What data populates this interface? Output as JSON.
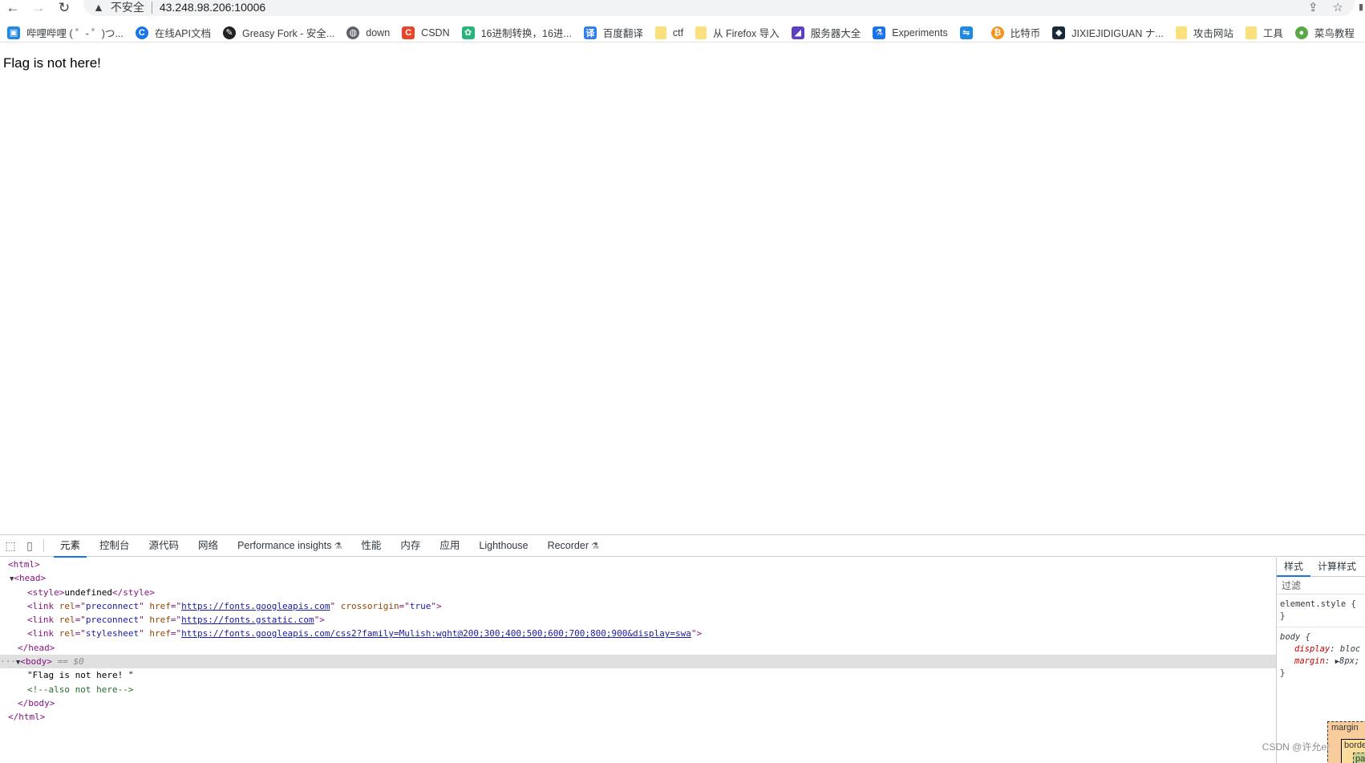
{
  "browser": {
    "security_label": "不安全",
    "url": "43.248.98.206:10006"
  },
  "bookmarks": [
    {
      "label": "哔哩哔哩 ( ゜- ゜)つ...",
      "icon": "bilibili-icon",
      "color": "#1e88e5"
    },
    {
      "label": "在线API文档",
      "icon": "c-logo-icon",
      "color": "#1a73e8"
    },
    {
      "label": "Greasy Fork - 安全...",
      "icon": "greasyfork-icon",
      "color": "#222222"
    },
    {
      "label": "down",
      "icon": "globe-icon",
      "color": "#5f6368"
    },
    {
      "label": "CSDN",
      "icon": "csdn-icon",
      "color": "#e8452a"
    },
    {
      "label": "16进制转换，16进...",
      "icon": "gear-icon",
      "color": "#28b47d"
    },
    {
      "label": "百度翻译",
      "icon": "translate-icon",
      "color": "#2f7ff0"
    },
    {
      "label": "ctf",
      "icon": "folder-icon",
      "color": "#fbe07b"
    },
    {
      "label": "从 Firefox 导入",
      "icon": "folder-icon",
      "color": "#fbe07b"
    },
    {
      "label": "服务器大全",
      "icon": "server-icon",
      "color": "#5b3fc4"
    },
    {
      "label": "Experiments",
      "icon": "flask-icon",
      "color": "#1a73e8"
    },
    {
      "label": "",
      "icon": "sync-icon",
      "color": "#1e88e5"
    },
    {
      "label": "比特币",
      "icon": "bitcoin-icon",
      "color": "#f7931a"
    },
    {
      "label": "JIXIEJIDIGUAN ナ...",
      "icon": "jixie-icon",
      "color": "#1b2a3a"
    },
    {
      "label": "攻击网站",
      "icon": "folder-icon",
      "color": "#fbe07b"
    },
    {
      "label": "工具",
      "icon": "folder-icon",
      "color": "#fbe07b"
    },
    {
      "label": "菜鸟教程",
      "icon": "runoob-icon",
      "color": "#5aa845"
    }
  ],
  "page": {
    "body_text": "Flag is not here!"
  },
  "devtools": {
    "tabs": [
      {
        "label": "元素",
        "active": true
      },
      {
        "label": "控制台"
      },
      {
        "label": "源代码"
      },
      {
        "label": "网络"
      },
      {
        "label": "Performance insights",
        "flask": true
      },
      {
        "label": "性能"
      },
      {
        "label": "内存"
      },
      {
        "label": "应用"
      },
      {
        "label": "Lighthouse"
      },
      {
        "label": "Recorder",
        "flask": true
      }
    ],
    "dom": {
      "html_open": "<html>",
      "head_open": "<head>",
      "style_open": "<style>",
      "style_content": "undefined",
      "style_close": "</style>",
      "link1": {
        "rel": "preconnect",
        "href": "https://fonts.googleapis.com",
        "crossorigin": "true"
      },
      "link2": {
        "rel": "preconnect",
        "href": "https://fonts.gstatic.com"
      },
      "link3": {
        "rel": "stylesheet",
        "href": "https://fonts.googleapis.com/css2?family=Mulish:wght@200;300;400;500;600;700;800;900&display=swa"
      },
      "head_close": "</head>",
      "body_open": "<body>",
      "body_marker": "== $0",
      "body_text": "\"Flag is not here! \"",
      "comment": "<!--also not here-->",
      "body_close": "</body>",
      "html_close": "</html>"
    },
    "styles": {
      "tabs": [
        "样式",
        "计算样式"
      ],
      "filter_placeholder": "过滤",
      "element_style_selector": "element.style {",
      "close_brace": "}",
      "body_selector": "body {",
      "display_prop": "display",
      "display_val": "bloc",
      "margin_prop": "margin",
      "margin_val": "8px;",
      "box_margin": "margin",
      "box_border": "borde",
      "box_padding": "pa"
    }
  },
  "watermark": "CSDN @许允er"
}
